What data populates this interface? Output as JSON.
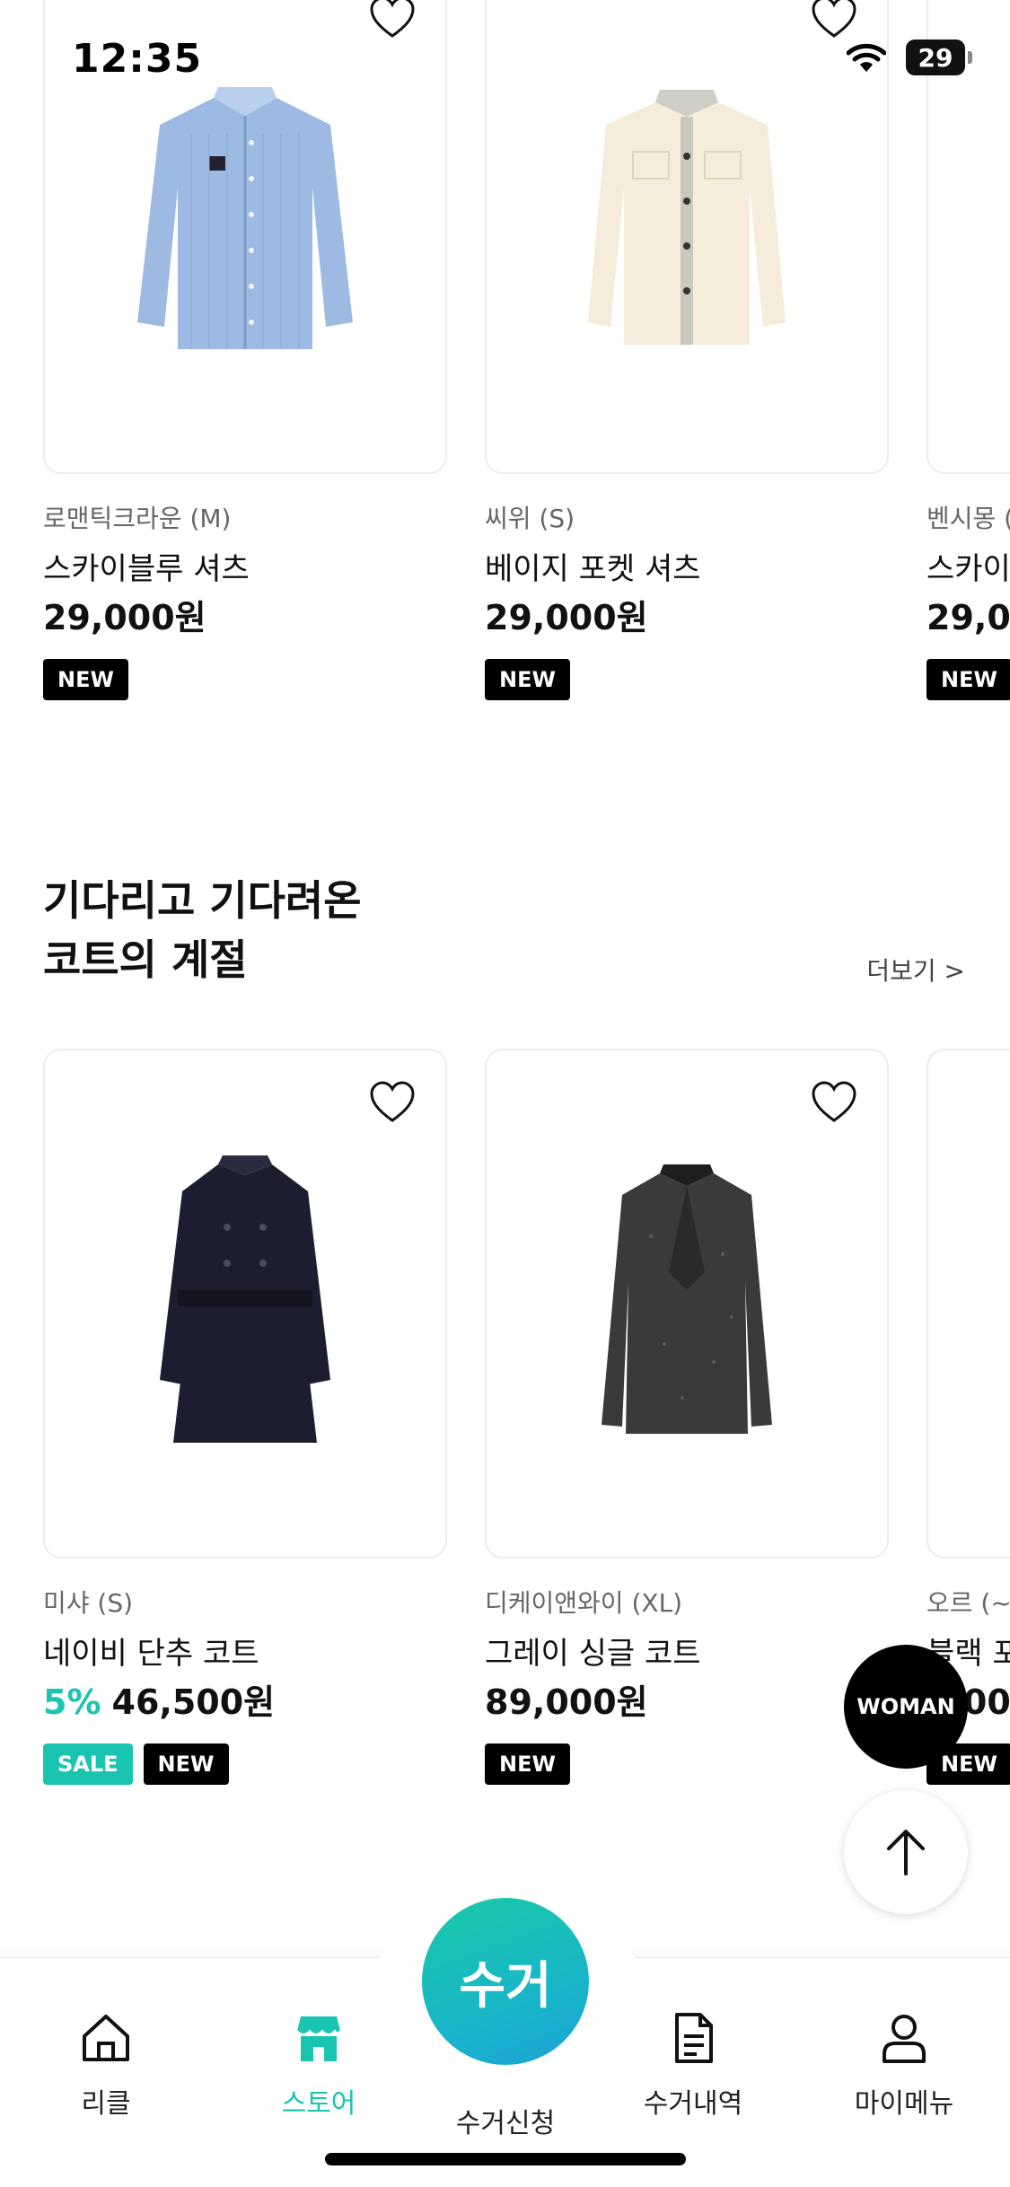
{
  "status_bar": {
    "time": "12:35",
    "battery": "29"
  },
  "row1": [
    {
      "brand": "로맨틱크라운 (M)",
      "name": "스카이블루 셔츠",
      "discount": "",
      "price": "29,000원",
      "badges": [
        "NEW"
      ]
    },
    {
      "brand": "씨위 (S)",
      "name": "베이지 포켓 셔츠",
      "discount": "",
      "price": "29,000원",
      "badges": [
        "NEW"
      ]
    },
    {
      "brand": "벤시몽 (",
      "name": "스카이",
      "discount": "",
      "price": "29,00",
      "badges": [
        "NEW"
      ]
    }
  ],
  "section": {
    "title_line1": "기다리고 기다려온",
    "title_line2": "코트의 계절",
    "more": "더보기 >"
  },
  "row2": [
    {
      "brand": "미샤 (S)",
      "name": "네이비 단추 코트",
      "discount": "5%",
      "price": "46,500원",
      "badges": [
        "SALE",
        "NEW"
      ]
    },
    {
      "brand": "디케이앤와이 (XL)",
      "name": "그레이 싱글 코트",
      "discount": "",
      "price": "89,000원",
      "badges": [
        "NEW"
      ]
    },
    {
      "brand": "오르 (~)",
      "name": "블랙 포",
      "discount": "",
      "price": "9,00",
      "badges": [
        "NEW"
      ]
    }
  ],
  "floating": {
    "woman": "WOMAN"
  },
  "nav": {
    "items": [
      {
        "label": "리클",
        "icon": "home-icon"
      },
      {
        "label": "스토어",
        "icon": "store-icon"
      },
      {
        "label": "수거신청",
        "icon": "pickup-button"
      },
      {
        "label": "수거내역",
        "icon": "document-icon"
      },
      {
        "label": "마이메뉴",
        "icon": "person-icon"
      }
    ],
    "fab": "수거"
  },
  "colors": {
    "accent": "#19c4b1",
    "badge_new": "#000000",
    "badge_sale": "#19c4b1"
  }
}
